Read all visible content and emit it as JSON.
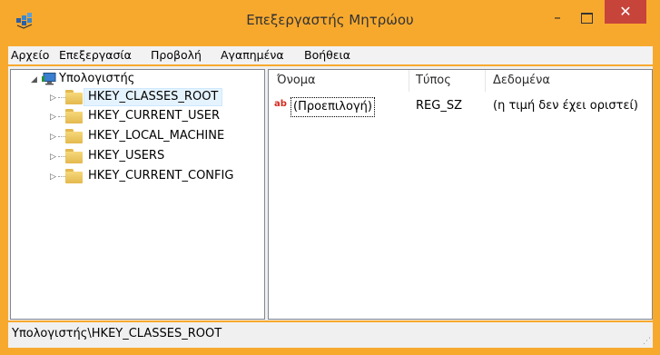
{
  "window": {
    "title": "Επεξεργαστής Μητρώου",
    "minimize_glyph": "–",
    "close_glyph": "✕",
    "app_icon": "registry-editor-icon"
  },
  "menubar": {
    "items": [
      "Αρχείο",
      "Επεξεργασία",
      "Προβολή",
      "Αγαπημένα",
      "Βοήθεια"
    ]
  },
  "tree": {
    "root": {
      "label": "Υπολογιστής",
      "icon": "computer-icon",
      "expanded": true
    },
    "expander_collapsed": "▷",
    "expander_expanded": "◢",
    "items": [
      {
        "label": "HKEY_CLASSES_ROOT",
        "selected": true
      },
      {
        "label": "HKEY_CURRENT_USER"
      },
      {
        "label": "HKEY_LOCAL_MACHINE"
      },
      {
        "label": "HKEY_USERS"
      },
      {
        "label": "HKEY_CURRENT_CONFIG"
      }
    ]
  },
  "listview": {
    "columns": [
      "Όνομα",
      "Τύπος",
      "Δεδομένα"
    ],
    "rows": [
      {
        "icon": "string-value-icon",
        "icon_text": "ab",
        "name": "(Προεπιλογή)",
        "type": "REG_SZ",
        "data": "(η τιμή δεν έχει οριστεί)"
      }
    ]
  },
  "statusbar": {
    "path": "Υπολογιστής\\HKEY_CLASSES_ROOT"
  },
  "colors": {
    "frame": "#f7a92e",
    "close_button": "#c7443b",
    "selection": "#e5f3ff"
  }
}
